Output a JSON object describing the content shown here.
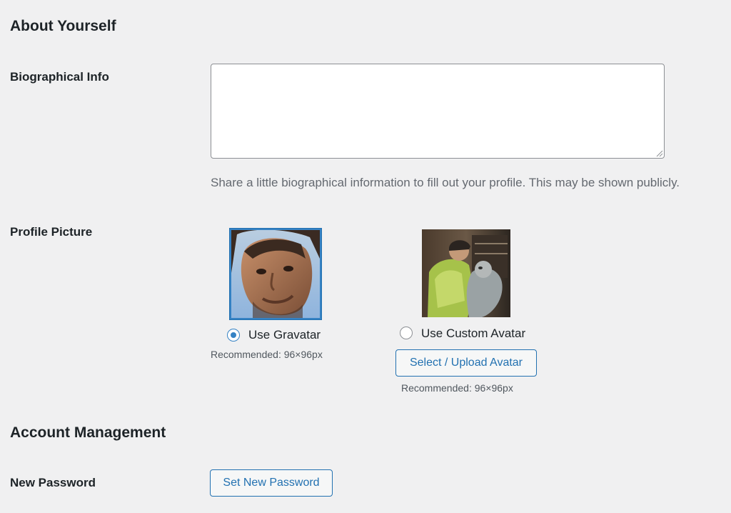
{
  "about": {
    "heading": "About Yourself",
    "bio": {
      "label": "Biographical Info",
      "value": "",
      "description": "Share a little biographical information to fill out your profile. This may be shown publicly."
    }
  },
  "profile_picture": {
    "label": "Profile Picture",
    "gravatar": {
      "option_label": "Use Gravatar",
      "selected": true,
      "recommended": "Recommended: 96×96px"
    },
    "custom": {
      "option_label": "Use Custom Avatar",
      "selected": false,
      "button_label": "Select / Upload Avatar",
      "recommended": "Recommended: 96×96px"
    }
  },
  "account": {
    "heading": "Account Management",
    "new_password": {
      "label": "New Password",
      "button_label": "Set New Password"
    }
  },
  "colors": {
    "background": "#f0f0f1",
    "accent": "#2271b1",
    "radio_checked": "#3582c4",
    "text": "#1d2327",
    "muted_text": "#646970"
  }
}
